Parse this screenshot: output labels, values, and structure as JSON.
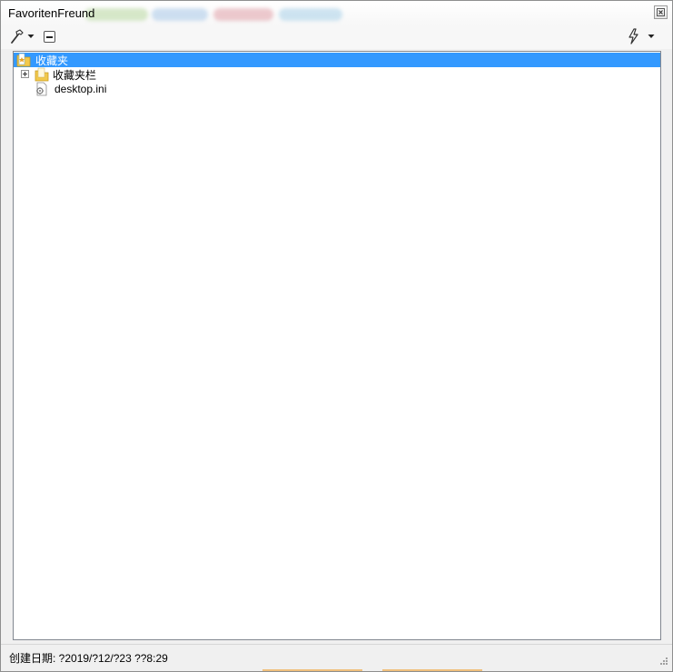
{
  "window": {
    "title": "FavoritenFreund"
  },
  "toolbar": {
    "tools_icon": "hammer-icon",
    "collapse_icon": "collapse-icon",
    "action_icon": "lightning-icon"
  },
  "tree": {
    "root": {
      "label": "收藏夹",
      "icon": "favorites-folder-icon",
      "selected": true
    },
    "children": [
      {
        "label": "收藏夹栏",
        "icon": "folder-icon",
        "expandable": true
      },
      {
        "label": "desktop.ini",
        "icon": "ini-file-icon",
        "expandable": false
      }
    ]
  },
  "status": {
    "text": "创建日期: ?2019/?12/?23 ??8:29"
  },
  "colors": {
    "selection": "#3399ff",
    "folder": "#f2c94c",
    "border": "#828790"
  }
}
